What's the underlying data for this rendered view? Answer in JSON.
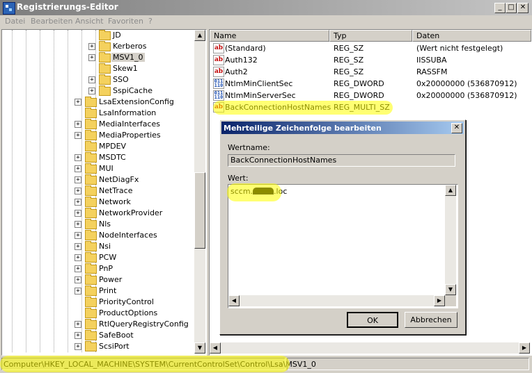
{
  "window": {
    "title": "Registrierungs-Editor",
    "minimize": "_",
    "maximize": "□",
    "close": "✕"
  },
  "menu": [
    "Datei",
    "Bearbeiten",
    "Ansicht",
    "Favoriten",
    "?"
  ],
  "tree": {
    "items": [
      {
        "label": "JD",
        "level": 2,
        "expander": ""
      },
      {
        "label": "Kerberos",
        "level": 2,
        "expander": "+"
      },
      {
        "label": "MSV1_0",
        "level": 2,
        "expander": "+",
        "selected": true
      },
      {
        "label": "Skew1",
        "level": 2,
        "expander": ""
      },
      {
        "label": "SSO",
        "level": 2,
        "expander": "+"
      },
      {
        "label": "SspiCache",
        "level": 2,
        "expander": "+"
      },
      {
        "label": "LsaExtensionConfig",
        "level": 1,
        "expander": "+"
      },
      {
        "label": "LsaInformation",
        "level": 1,
        "expander": ""
      },
      {
        "label": "MediaInterfaces",
        "level": 1,
        "expander": "+"
      },
      {
        "label": "MediaProperties",
        "level": 1,
        "expander": "+"
      },
      {
        "label": "MPDEV",
        "level": 1,
        "expander": ""
      },
      {
        "label": "MSDTC",
        "level": 1,
        "expander": "+"
      },
      {
        "label": "MUI",
        "level": 1,
        "expander": "+"
      },
      {
        "label": "NetDiagFx",
        "level": 1,
        "expander": "+"
      },
      {
        "label": "NetTrace",
        "level": 1,
        "expander": "+"
      },
      {
        "label": "Network",
        "level": 1,
        "expander": "+"
      },
      {
        "label": "NetworkProvider",
        "level": 1,
        "expander": "+"
      },
      {
        "label": "Nls",
        "level": 1,
        "expander": "+"
      },
      {
        "label": "NodeInterfaces",
        "level": 1,
        "expander": "+"
      },
      {
        "label": "Nsi",
        "level": 1,
        "expander": "+"
      },
      {
        "label": "PCW",
        "level": 1,
        "expander": "+"
      },
      {
        "label": "PnP",
        "level": 1,
        "expander": "+"
      },
      {
        "label": "Power",
        "level": 1,
        "expander": "+"
      },
      {
        "label": "Print",
        "level": 1,
        "expander": "+"
      },
      {
        "label": "PriorityControl",
        "level": 1,
        "expander": ""
      },
      {
        "label": "ProductOptions",
        "level": 1,
        "expander": ""
      },
      {
        "label": "RtlQueryRegistryConfig",
        "level": 1,
        "expander": "+"
      },
      {
        "label": "SafeBoot",
        "level": 1,
        "expander": "+"
      },
      {
        "label": "ScsiPort",
        "level": 1,
        "expander": "+"
      }
    ]
  },
  "list": {
    "columns": [
      "Name",
      "Typ",
      "Daten"
    ],
    "rows": [
      {
        "name": "(Standard)",
        "type": "REG_SZ",
        "data": "(Wert nicht festgelegt)",
        "icon": "string-value-icon"
      },
      {
        "name": "Auth132",
        "type": "REG_SZ",
        "data": "IISSUBA",
        "icon": "string-value-icon"
      },
      {
        "name": "Auth2",
        "type": "REG_SZ",
        "data": "RASSFM",
        "icon": "string-value-icon"
      },
      {
        "name": "NtlmMinClientSec",
        "type": "REG_DWORD",
        "data": "0x20000000 (536870912)",
        "icon": "binary-value-icon"
      },
      {
        "name": "NtlmMinServerSec",
        "type": "REG_DWORD",
        "data": "0x20000000 (536870912)",
        "icon": "binary-value-icon"
      },
      {
        "name": "BackConnectionHostNames",
        "type": "REG_MULTI_SZ",
        "data": "",
        "icon": "string-value-icon"
      }
    ]
  },
  "dialog": {
    "title": "Mehrteilige Zeichenfolge bearbeiten",
    "close": "✕",
    "name_label": "Wertname:",
    "name_value": "BackConnectionHostNames",
    "value_label": "Wert:",
    "value_text_before": "sccm.",
    "value_text_after": ".loc",
    "ok": "OK",
    "cancel": "Abbrechen"
  },
  "status": {
    "path": "Computer\\HKEY_LOCAL_MACHINE\\SYSTEM\\CurrentControlSet\\Control\\Lsa\\MSV1_0"
  },
  "colors": {
    "highlight": "#ffff00",
    "dialog_title": "#0a246a",
    "selection": "#d4d0c8"
  }
}
